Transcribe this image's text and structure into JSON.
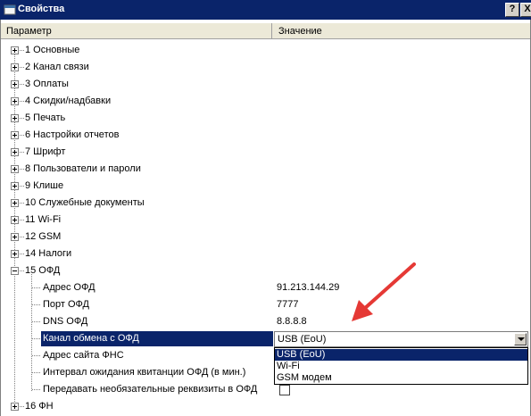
{
  "window": {
    "title": "Свойства",
    "help_label": "?",
    "close_label": "X"
  },
  "columns": {
    "param": "Параметр",
    "value": "Значение"
  },
  "groups": [
    {
      "label": "1 Основные"
    },
    {
      "label": "2 Канал связи"
    },
    {
      "label": "3 Оплаты"
    },
    {
      "label": "4 Скидки/надбавки"
    },
    {
      "label": "5 Печать"
    },
    {
      "label": "6 Настройки отчетов"
    },
    {
      "label": "7 Шрифт"
    },
    {
      "label": "8 Пользователи и пароли"
    },
    {
      "label": "9 Клише"
    },
    {
      "label": "10 Служебные документы"
    },
    {
      "label": "11 Wi-Fi"
    },
    {
      "label": "12 GSM"
    },
    {
      "label": "14 Налоги"
    }
  ],
  "ofd": {
    "label": "15 ОФД",
    "items": [
      {
        "label": "Адрес ОФД",
        "value": "91.213.144.29"
      },
      {
        "label": "Порт ОФД",
        "value": "7777"
      },
      {
        "label": "DNS ОФД",
        "value": "8.8.8.8"
      },
      {
        "label": "Канал обмена с ОФД",
        "value": ""
      },
      {
        "label": "Адрес сайта ФНС",
        "value": ""
      },
      {
        "label": "Интервал ожидания квитанции ОФД (в мин.)",
        "value": ""
      },
      {
        "label": "Передавать необязательные реквизиты в ОФД",
        "value": ""
      }
    ]
  },
  "fn": {
    "label": "16 ФН"
  },
  "combo": {
    "selected": "USB (EoU)",
    "options": [
      "USB (EoU)",
      "Wi-Fi",
      "GSM модем"
    ]
  },
  "colors": {
    "selection": "#0a246a",
    "arrow": "#e53935",
    "titlebar": "#0a246a"
  }
}
